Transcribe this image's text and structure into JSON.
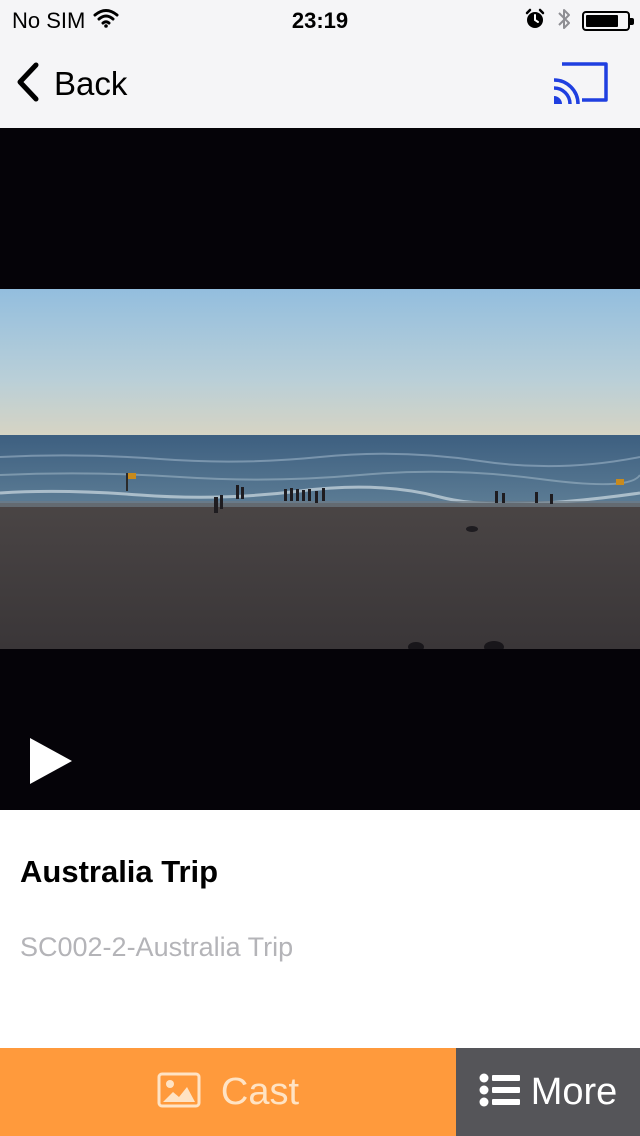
{
  "status_bar": {
    "carrier": "No SIM",
    "time": "23:19",
    "battery_level": 0.8
  },
  "nav": {
    "back_label": "Back",
    "cast_icon_color": "#1f3fe0"
  },
  "video": {
    "title": "Australia Trip",
    "subtitle": "SC002-2-Australia Trip"
  },
  "bottom_tabs": {
    "cast_label": "Cast",
    "more_label": "More",
    "cast_bg": "#ff9a3c",
    "more_bg": "#555559"
  },
  "icons": [
    "wifi-icon",
    "alarm-icon",
    "bluetooth-icon",
    "battery-icon",
    "back-chevron-icon",
    "cast-icon",
    "play-icon",
    "image-icon",
    "list-icon"
  ]
}
